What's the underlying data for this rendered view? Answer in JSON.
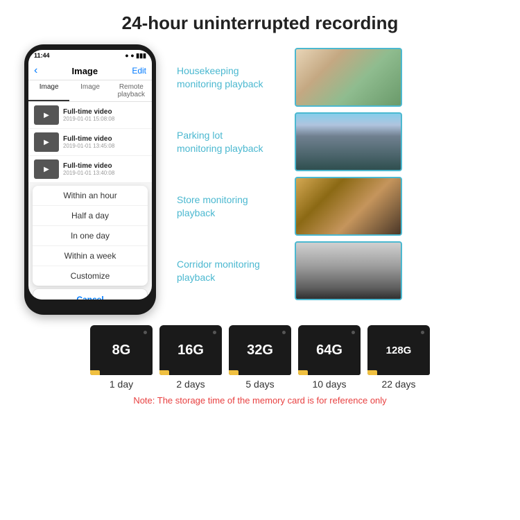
{
  "title": "24-hour uninterrupted recording",
  "phone": {
    "time": "11:44",
    "nav": {
      "back": "‹",
      "title": "Image",
      "edit": "Edit"
    },
    "tabs": [
      "Image",
      "Image",
      "Remote playback"
    ],
    "videos": [
      {
        "title": "Full-time video",
        "date": "2019-01-01 15:08:08"
      },
      {
        "title": "Full-time video",
        "date": "2019-01-01 13:45:08"
      },
      {
        "title": "Full-time video",
        "date": "2019-01-01 13:40:08"
      }
    ],
    "dropdown": {
      "items": [
        "Within an hour",
        "Half a day",
        "In one day",
        "Within a week",
        "Customize"
      ],
      "cancel": "Cancel"
    }
  },
  "monitoring": [
    {
      "label": "Housekeeping\nmonitoring playback",
      "imgClass": "img-housekeeping"
    },
    {
      "label": "Parking lot\nmonitoring playback",
      "imgClass": "img-parking"
    },
    {
      "label": "Store monitoring\nplayback",
      "imgClass": "img-store"
    },
    {
      "label": "Corridor monitoring\nplayback",
      "imgClass": "img-corridor"
    }
  ],
  "storage": {
    "cards": [
      {
        "size": "8G",
        "days": "1 day"
      },
      {
        "size": "16G",
        "days": "2 days"
      },
      {
        "size": "32G",
        "days": "5 days"
      },
      {
        "size": "64G",
        "days": "10 days"
      },
      {
        "size": "128G",
        "days": "22 days"
      }
    ],
    "note": "Note: The storage time of the memory card is for reference only"
  }
}
